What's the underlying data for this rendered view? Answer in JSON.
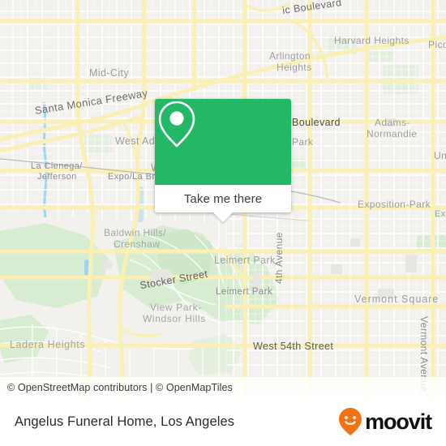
{
  "map": {
    "attribution": "© OpenStreetMap contributors | © OpenMapTiles",
    "labels": {
      "pico_boulevard": "ic Boulevard",
      "harvard_heights": "Harvard Heights",
      "pico_union": "Pico-",
      "arlington_heights_1": "Arlington",
      "arlington_heights_2": "Heights",
      "mid_city": "Mid-City",
      "santa_monica_freeway": "Santa Monica Freeway",
      "west_adams": "West Ada",
      "washington_blvd": "W",
      "jefferson_blvd": "Boulevard",
      "adams_normandie_1": "Adams-",
      "adams_normandie_2": "Normandie",
      "university_park": "Un",
      "la_cienega_jefferson_1": "La Cienega/",
      "la_cienega_jefferson_2": "Jefferson",
      "expo_la_brea": "Expo/La Brea",
      "crenshaw_park": "Park",
      "exposition_park": "Exposition-Park",
      "expo_station": "Exp",
      "baldwin_hills_1": "Baldwin Hills/",
      "baldwin_hills_2": "Crenshaw",
      "stocker_street": "Stocker Street",
      "leimert_park_area": "Leimert Park",
      "leimert_park_point": "Leimert Park",
      "fourth_avenue": "4th Avenue",
      "vermont_square": "Vermont Square",
      "vermont_avenue": "Vermont Avenue",
      "view_park_1": "View Park-",
      "view_park_2": "Windsor Hills",
      "ladera_heights": "Ladera Heights",
      "west_54th_street": "West 54th Street"
    },
    "colors": {
      "land": "#f2f1ee",
      "minor_road": "#ffffff",
      "major_road": "#faf0b6",
      "park": "#d8ecd2",
      "water": "#9fd3ef",
      "building": "#e8e6e1"
    }
  },
  "popup": {
    "icon": "map-pin-icon",
    "action_label": "Take me there",
    "accent_color": "#22b865"
  },
  "footer": {
    "title": "Angelus Funeral Home, Los Angeles",
    "brand_name": "moovit",
    "brand_icon": "moovit-smile-pin-icon",
    "brand_color": "#f47216"
  }
}
